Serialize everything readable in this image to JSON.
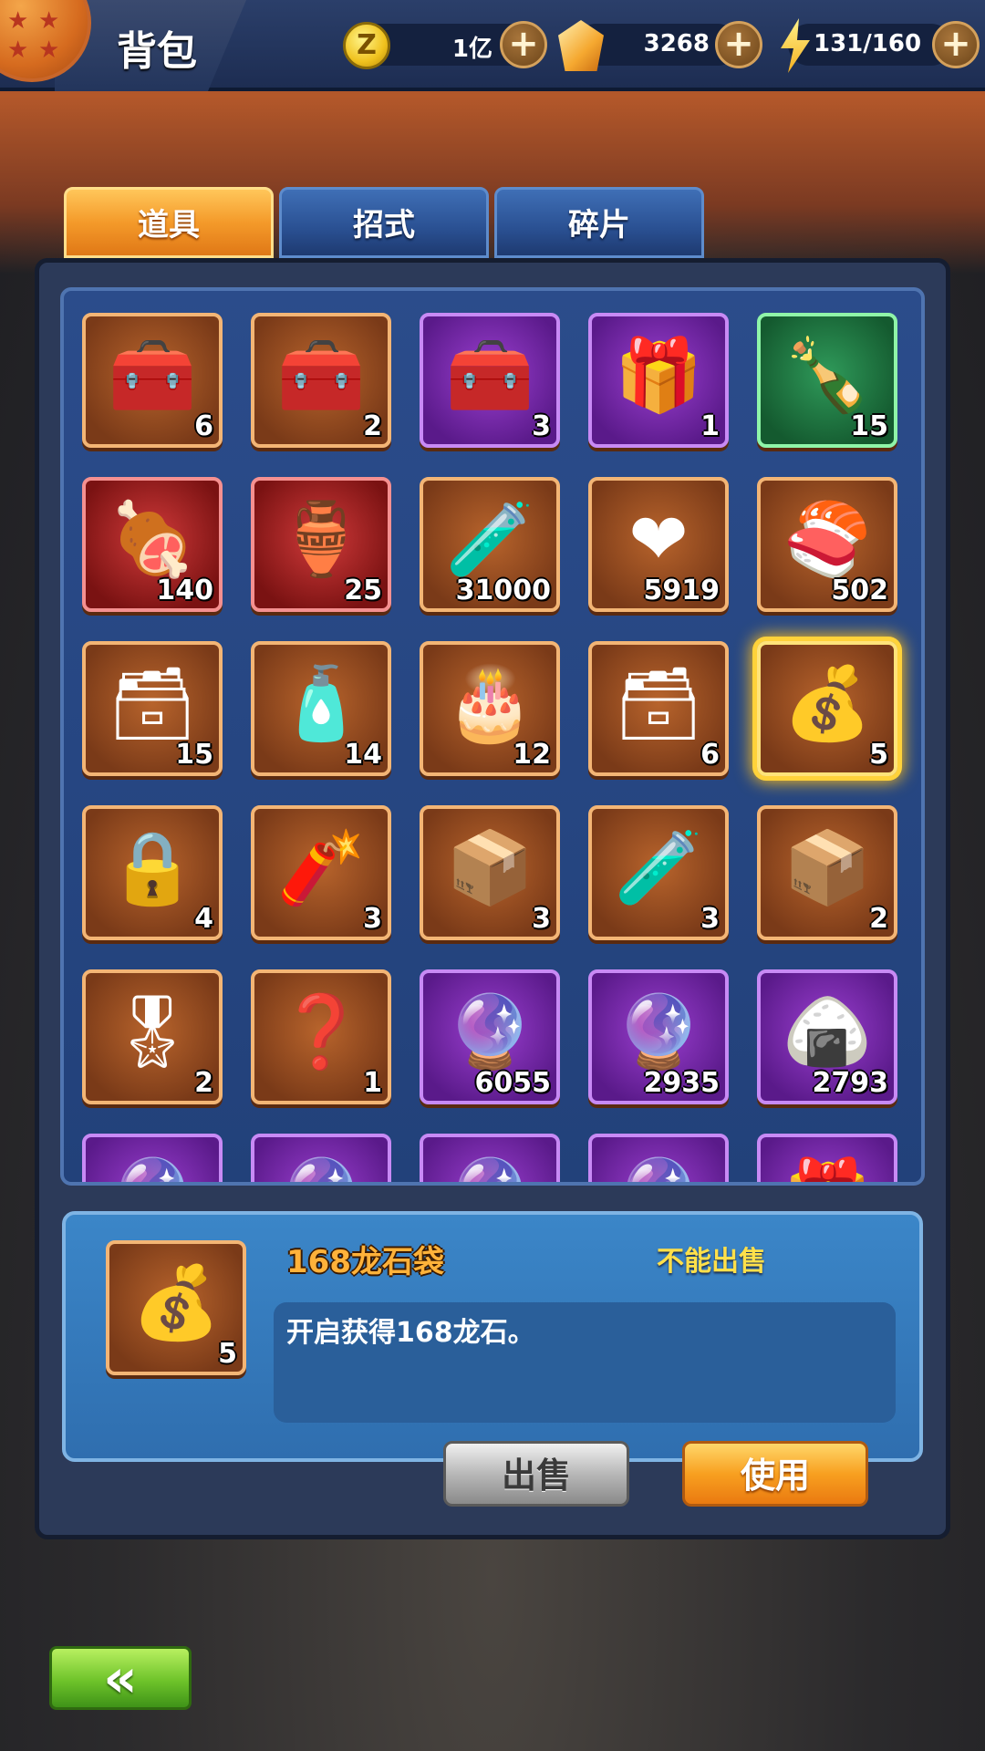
{
  "header": {
    "title": "背包",
    "zeni_value": "1亿",
    "crystal_value": "3268",
    "stamina_value": "131/160"
  },
  "tabs": [
    {
      "label": "道具",
      "active": true
    },
    {
      "label": "招式",
      "active": false
    },
    {
      "label": "碎片",
      "active": false
    }
  ],
  "items": [
    {
      "icon": "orange-z-chest",
      "count": "6",
      "quality": "orange"
    },
    {
      "icon": "orange-z-chest",
      "count": "2",
      "quality": "orange"
    },
    {
      "icon": "purple-z-chest",
      "count": "3",
      "quality": "purple"
    },
    {
      "icon": "battle-gift-box",
      "count": "1",
      "quality": "purple"
    },
    {
      "icon": "energy-bottle",
      "count": "15",
      "quality": "green"
    },
    {
      "icon": "roast-meat",
      "count": "140",
      "quality": "red"
    },
    {
      "icon": "silver-potion",
      "count": "25",
      "quality": "red"
    },
    {
      "icon": "purple-potion",
      "count": "31000",
      "quality": "orange"
    },
    {
      "icon": "crystal-heart",
      "count": "5919",
      "quality": "orange"
    },
    {
      "icon": "sushi-platter",
      "count": "502",
      "quality": "orange"
    },
    {
      "icon": "purple-treasure-chest",
      "count": "15",
      "quality": "orange"
    },
    {
      "icon": "blue-potion",
      "count": "14",
      "quality": "orange"
    },
    {
      "icon": "birthday-cake",
      "count": "12",
      "quality": "orange"
    },
    {
      "icon": "green-treasure-chest",
      "count": "6",
      "quality": "orange"
    },
    {
      "icon": "dragon-stone-bag",
      "count": "5",
      "quality": "orange",
      "selected": true
    },
    {
      "icon": "purple-z-lockbox",
      "count": "4",
      "quality": "orange"
    },
    {
      "icon": "firecrackers",
      "count": "3",
      "quality": "orange"
    },
    {
      "icon": "blue-gold-chest",
      "count": "3",
      "quality": "orange"
    },
    {
      "icon": "mystery-bottle-red",
      "count": "3",
      "quality": "orange"
    },
    {
      "icon": "blue-gold-chest",
      "count": "2",
      "quality": "orange"
    },
    {
      "icon": "martial-chest",
      "count": "2",
      "quality": "orange"
    },
    {
      "icon": "mystery-bottle",
      "count": "1",
      "quality": "orange"
    },
    {
      "icon": "yellow-orb",
      "count": "6055",
      "quality": "purple"
    },
    {
      "icon": "violet-orb",
      "count": "2935",
      "quality": "purple"
    },
    {
      "icon": "rice-ball-tray",
      "count": "2793",
      "quality": "purple"
    },
    {
      "icon": "green-orb",
      "count": "",
      "quality": "purple"
    },
    {
      "icon": "red-orb",
      "count": "",
      "quality": "purple"
    },
    {
      "icon": "purple-orb",
      "count": "",
      "quality": "purple"
    },
    {
      "icon": "violet-orb",
      "count": "",
      "quality": "purple"
    },
    {
      "icon": "gift-box",
      "count": "",
      "quality": "purple"
    }
  ],
  "detail": {
    "name": "168龙石袋",
    "sell_status": "不能出售",
    "description": "开启获得168龙石。",
    "count": "5",
    "icon": "dragon-stone-bag"
  },
  "buttons": {
    "sell": "出售",
    "use": "使用",
    "back": "«"
  }
}
